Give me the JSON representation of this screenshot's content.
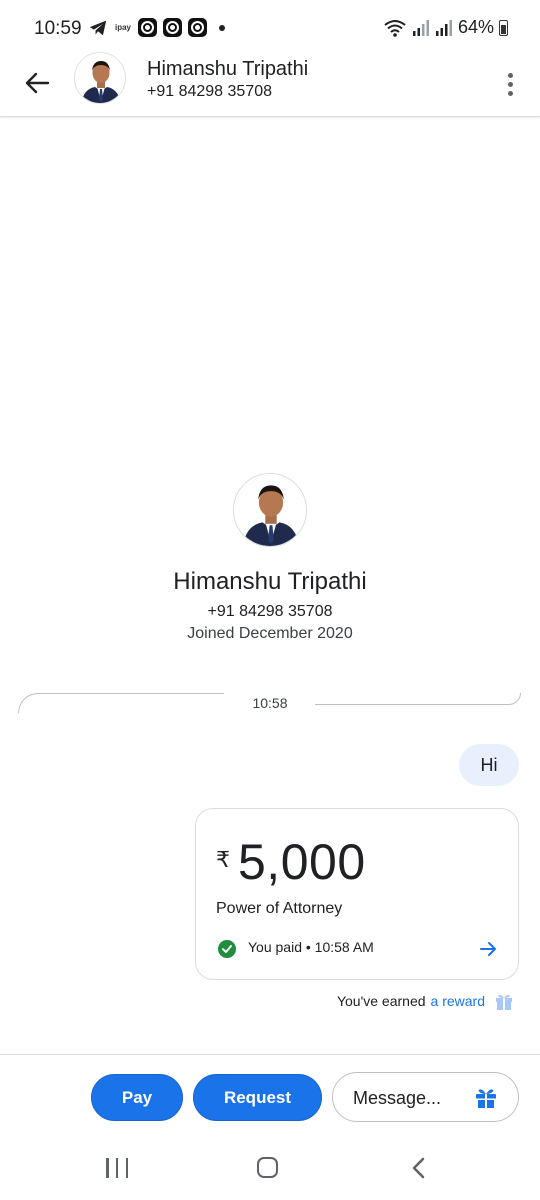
{
  "status_bar": {
    "time": "10:59",
    "battery": "64%",
    "small_icon_text": "ipay"
  },
  "header": {
    "name": "Himanshu Tripathi",
    "phone": "+91 84298 35708"
  },
  "profile": {
    "name": "Himanshu Tripathi",
    "phone": "+91 84298 35708",
    "joined": "Joined December 2020"
  },
  "conversation": {
    "divider_time": "10:58",
    "sent_message": "Hi",
    "payment": {
      "currency_symbol": "₹",
      "amount": "5,000",
      "note": "Power of Attorney",
      "status": "You paid • 10:58 AM"
    },
    "reward": {
      "prefix": "You've earned",
      "link": "a reward"
    }
  },
  "bottom_bar": {
    "pay_label": "Pay",
    "request_label": "Request",
    "message_placeholder": "Message..."
  },
  "colors": {
    "accent": "#1a73e8",
    "bubble": "#e8f0fe",
    "success": "#1e8e3e"
  }
}
